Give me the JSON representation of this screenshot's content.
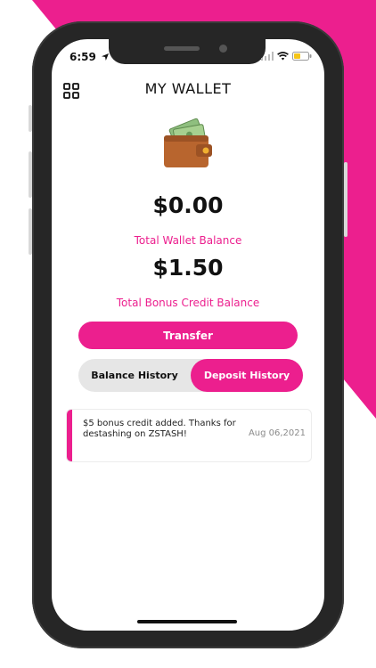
{
  "colors": {
    "accent": "#ec1f8e",
    "device_frame": "#262626",
    "tab_background": "#e6e6e6"
  },
  "status_bar": {
    "time": "6:59",
    "location_icon": "location-arrow-icon",
    "signal_icon": "cellular-signal-icon",
    "wifi_icon": "wifi-icon",
    "battery_icon": "battery-icon"
  },
  "header": {
    "title": "MY WALLET",
    "menu_icon": "grid-menu-icon"
  },
  "wallet": {
    "icon": "wallet-icon",
    "balance": "$0.00",
    "balance_label": "Total Wallet Balance",
    "bonus_balance": "$1.50",
    "bonus_label": "Total Bonus Credit Balance"
  },
  "actions": {
    "transfer_label": "Transfer"
  },
  "tabs": [
    {
      "label": "Balance History",
      "active": false
    },
    {
      "label": "Deposit History",
      "active": true
    }
  ],
  "history": [
    {
      "text": "$5 bonus credit added. Thanks for destashing on ZSTASH!",
      "date": "Aug 06,2021"
    }
  ]
}
